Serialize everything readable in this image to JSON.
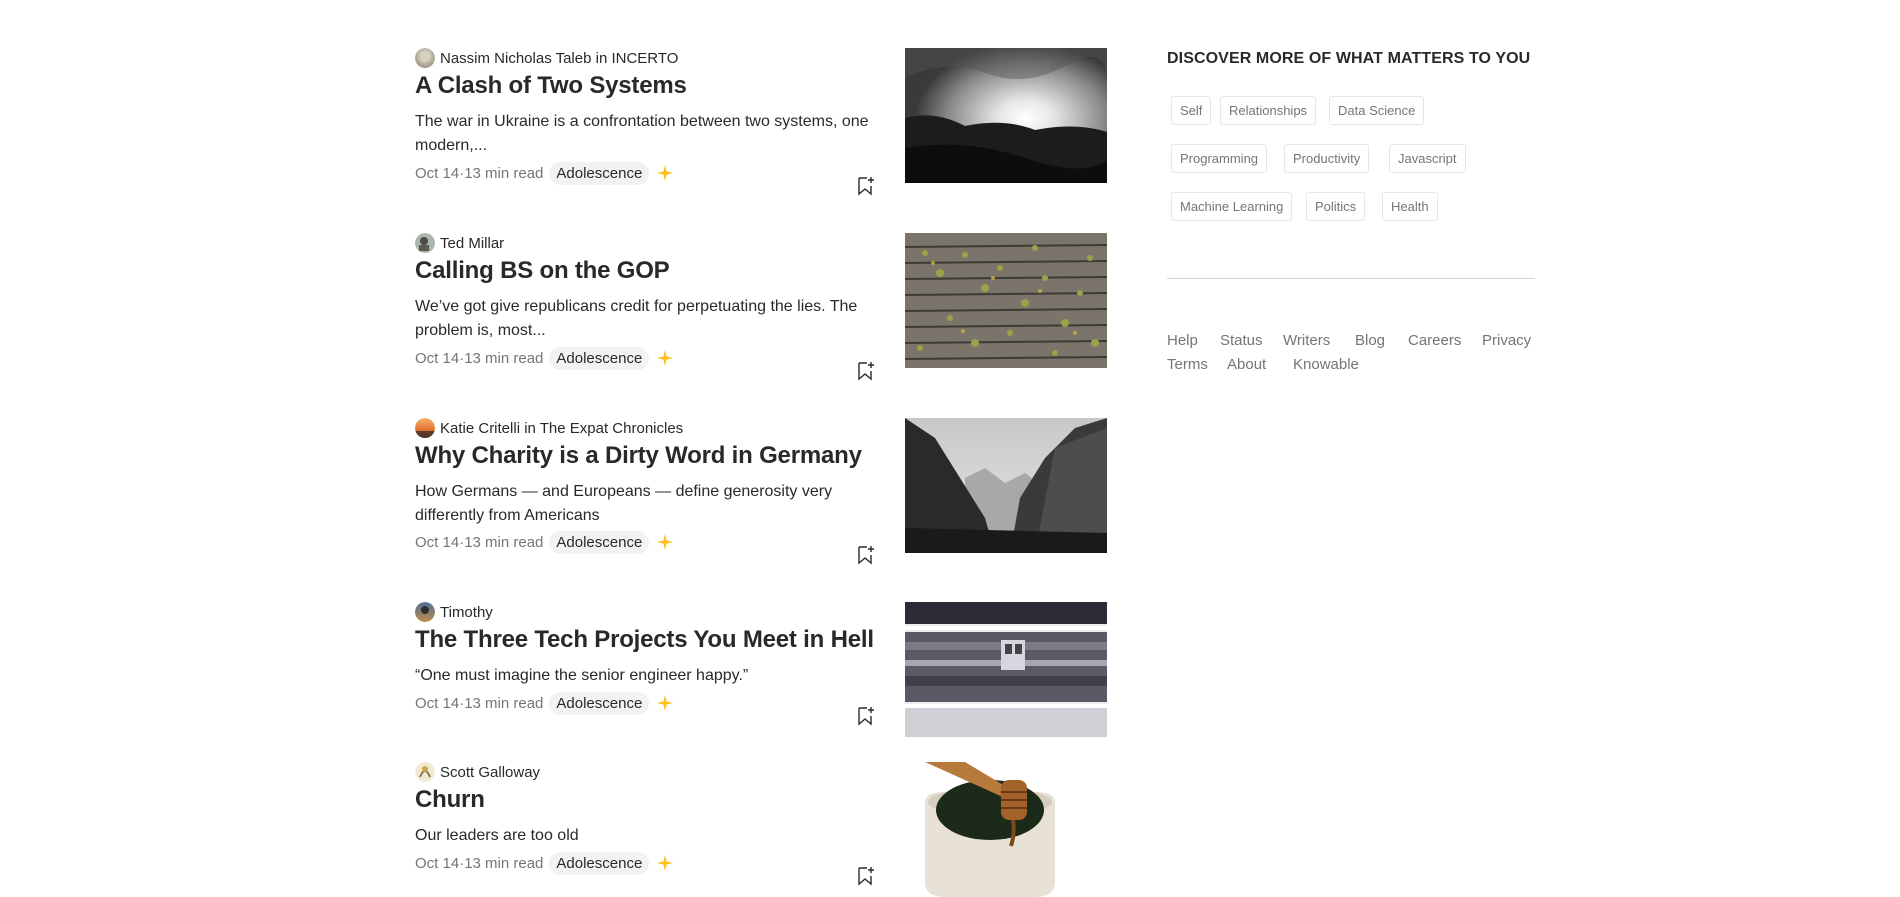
{
  "feed": {
    "posts": [
      {
        "author": "Nassim Nicholas Taleb in INCERTO",
        "title": "A Clash of Two Systems",
        "subtitle": "The war in Ukraine is a confrontation between two systems, one modern,...",
        "date": "Oct 14",
        "read_time": "13 min read",
        "tag": "Adolescence",
        "thumbnail": "black-and-white sunset over hills"
      },
      {
        "author": "Ted Millar",
        "title": "Calling BS on the GOP",
        "subtitle": "We’ve got give republicans credit for perpetuating the lies. The problem is, most...",
        "date": "Oct 14",
        "read_time": "13 min read",
        "tag": "Adolescence",
        "thumbnail": "wooden planks with ivy"
      },
      {
        "author": "Katie Critelli in The Expat Chronicles",
        "title": "Why Charity is a Dirty Word in Germany",
        "subtitle": "How Germans — and Europeans — define generosity very differently from Americans",
        "date": "Oct 14",
        "read_time": "13 min read",
        "tag": "Adolescence",
        "thumbnail": "black-and-white mountain valley"
      },
      {
        "author": "Timothy",
        "title": "The Three Tech Projects You Meet in Hell",
        "subtitle": "“One must imagine the senior engineer happy.”",
        "date": "Oct 14",
        "read_time": "13 min read",
        "tag": "Adolescence",
        "thumbnail": "motion-blurred train"
      },
      {
        "author": "Scott Galloway",
        "title": "Churn",
        "subtitle": "Our leaders are too old",
        "date": "Oct 14",
        "read_time": "13 min read",
        "tag": "Adolescence",
        "thumbnail": "honey dipper in a jar"
      }
    ]
  },
  "sidebar": {
    "heading": "DISCOVER MORE OF WHAT MATTERS TO YOU",
    "topics": [
      "Self",
      "Relationships",
      "Data Science",
      "Programming",
      "Productivity",
      "Javascript",
      "Machine Learning",
      "Politics",
      "Health"
    ],
    "footer_links": [
      "Help",
      "Status",
      "Writers",
      "Blog",
      "Careers",
      "Privacy",
      "Terms",
      "About",
      "Knowable"
    ]
  },
  "colors": {
    "text": "#292929",
    "muted": "#757575",
    "star": "#ffc017",
    "tag_bg": "#f2f2f2",
    "chip_border": "#e6e6e6"
  }
}
